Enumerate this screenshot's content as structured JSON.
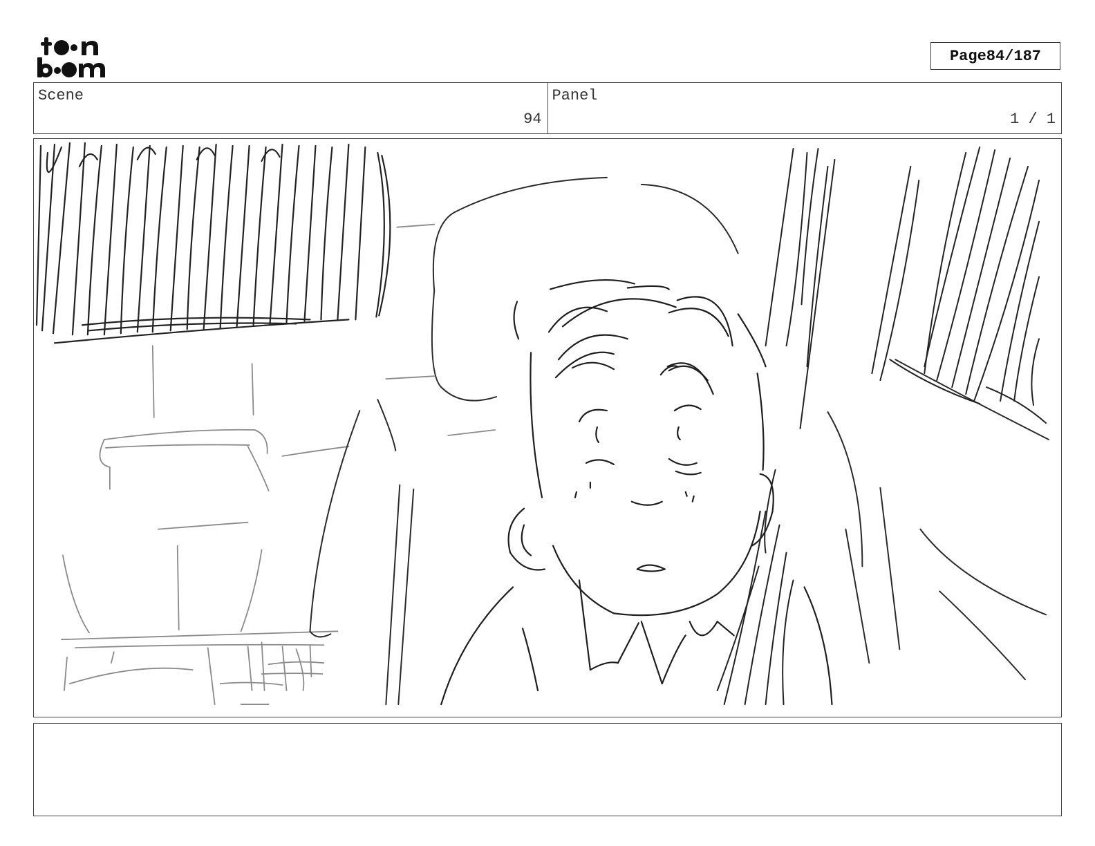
{
  "header": {
    "page_label": "Page",
    "page_number": "84/187"
  },
  "info": {
    "scene_label": "Scene",
    "scene_value": "94",
    "panel_label": "Panel",
    "panel_value": "1 / 1"
  },
  "notes": {
    "text": ""
  }
}
